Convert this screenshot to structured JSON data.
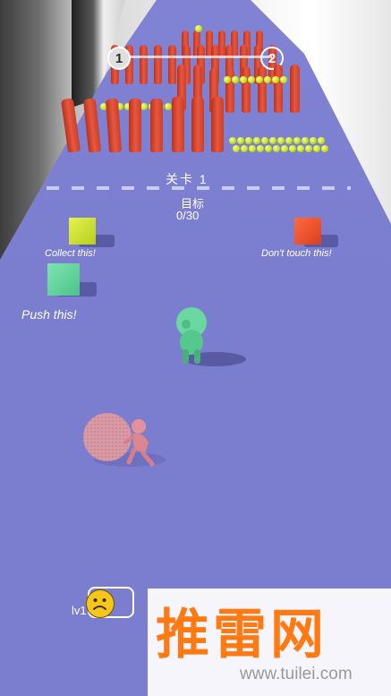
{
  "hud": {
    "progress_start": "1",
    "progress_end": "2",
    "level_label": "关卡 1",
    "goal_label": "目标",
    "goal_count": "0/30",
    "player_level": "lv1"
  },
  "hints": {
    "collect": "Collect this!",
    "avoid": "Don't touch this!",
    "push": "Push this!"
  },
  "colors": {
    "floor": "#7b7dcf",
    "collect_cube": "#c8e02a",
    "avoid_cube": "#f0512b",
    "push_cube": "#5fd39a",
    "player": "#5fd39a",
    "rival": "#d98b96",
    "pole": "#e8573e",
    "ball": "#c3e01f",
    "watermark": "#ff7a12"
  },
  "watermark": {
    "main": "推雷网",
    "url": "www.tuilei.com"
  }
}
